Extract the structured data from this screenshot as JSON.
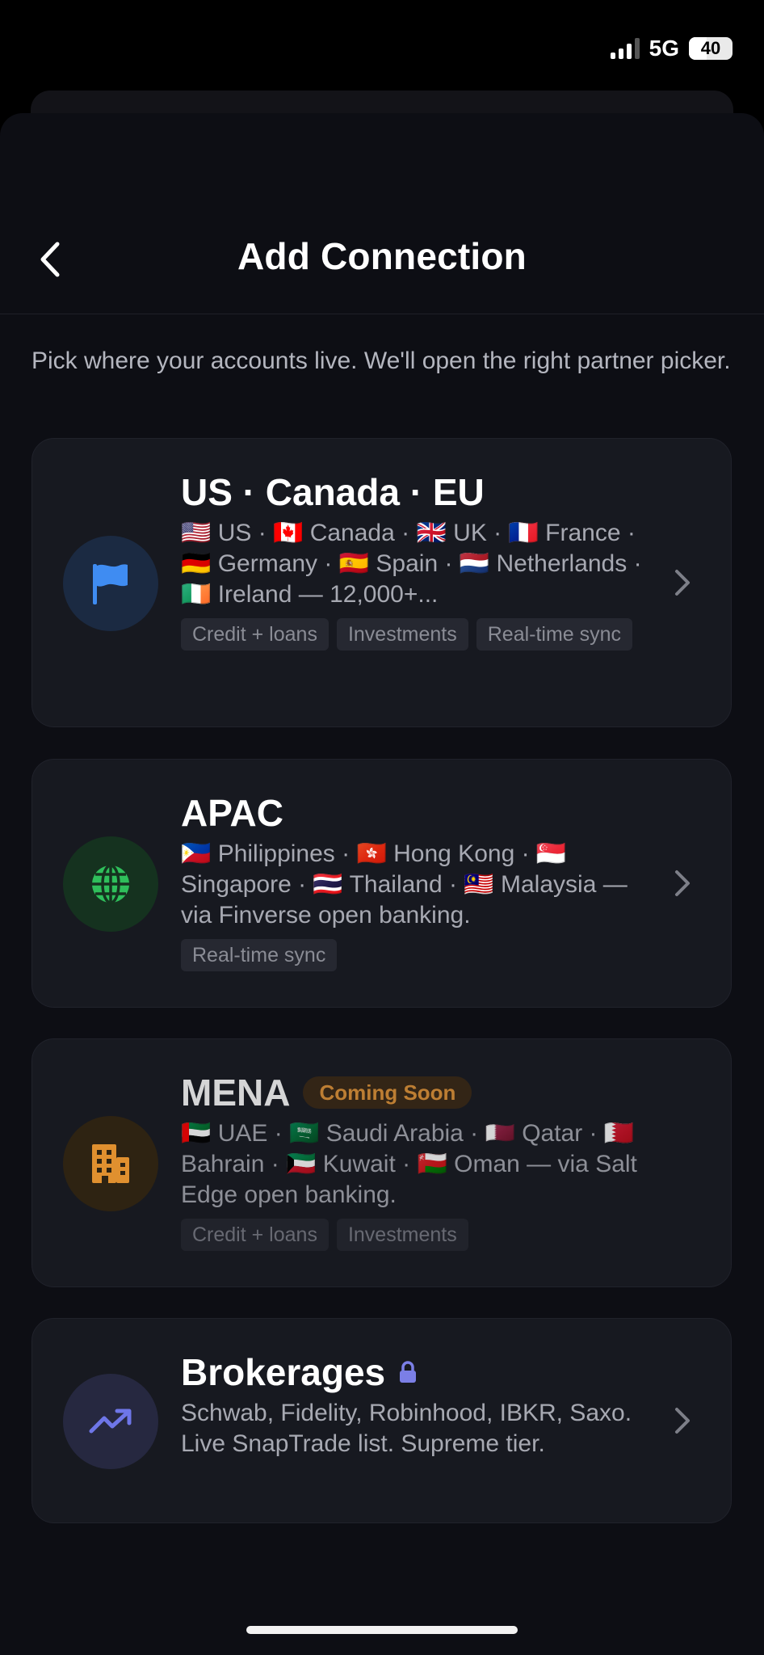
{
  "status_bar": {
    "network": "5G",
    "battery": "40"
  },
  "header": {
    "title": "Add Connection"
  },
  "subtitle": "Pick where your accounts live. We'll open the right partner picker.",
  "cards": [
    {
      "title": "US · Canada · EU",
      "description": "🇺🇸 US · 🇨🇦 Canada · 🇬🇧 UK · 🇫🇷 France · 🇩🇪 Germany · 🇪🇸 Spain · 🇳🇱 Netherlands · 🇮🇪 Ireland — 12,000+...",
      "tags": [
        "Credit + loans",
        "Investments",
        "Real-time sync"
      ],
      "icon": "flag-icon",
      "accent": "#3f8cf2"
    },
    {
      "title": "APAC",
      "description": "🇵🇭 Philippines · 🇭🇰 Hong Kong · 🇸🇬 Singapore · 🇹🇭 Thailand · 🇲🇾 Malaysia — via Finverse open banking.",
      "tags": [
        "Real-time sync"
      ],
      "icon": "globe-icon",
      "accent": "#2fbf5b"
    },
    {
      "title": "MENA",
      "badge": "Coming Soon",
      "description": "🇦🇪 UAE · 🇸🇦 Saudi Arabia · 🇶🇦 Qatar · 🇧🇭 Bahrain · 🇰🇼 Kuwait · 🇴🇲 Oman — via Salt Edge open banking.",
      "tags": [
        "Credit + loans",
        "Investments"
      ],
      "icon": "building-icon",
      "accent": "#e0902f"
    },
    {
      "title": "Brokerages",
      "description": "Schwab, Fidelity, Robinhood, IBKR, Saxo. Live SnapTrade list. Supreme tier.",
      "tags": [],
      "icon": "trending-up-icon",
      "accent": "#6e76e8",
      "locked": true
    }
  ]
}
